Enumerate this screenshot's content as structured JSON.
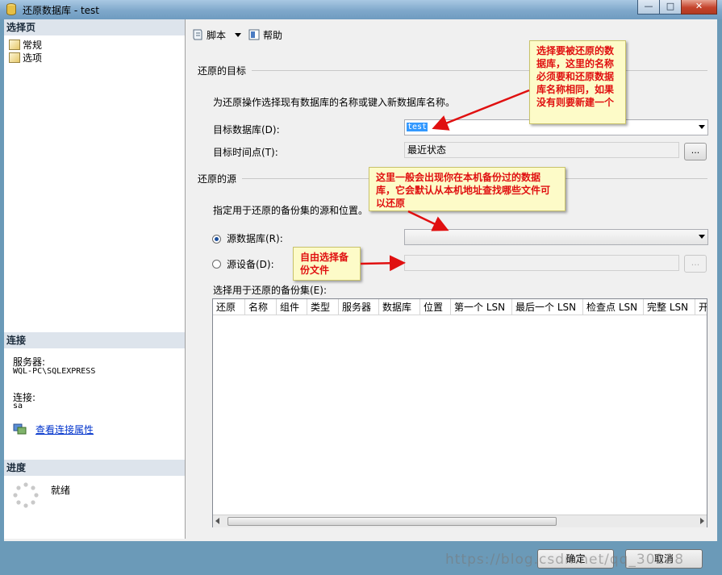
{
  "window": {
    "title": "还原数据库 - test",
    "close_glyph": "✕",
    "max_glyph": "□",
    "min_glyph": "—"
  },
  "left": {
    "select_page_header": "选择页",
    "pages": [
      {
        "label": "常规",
        "icon": "page-general-icon"
      },
      {
        "label": "选项",
        "icon": "page-options-icon"
      }
    ],
    "connection_header": "连接",
    "server_label": "服务器:",
    "server_value": "WQL-PC\\SQLEXPRESS",
    "connection_label": "连接:",
    "connection_value": "sa",
    "view_connection_link": "查看连接属性",
    "progress_header": "进度",
    "status_text": "就绪"
  },
  "toolbar": {
    "script_label": "脚本",
    "help_label": "帮助"
  },
  "restore_target": {
    "group_title": "还原的目标",
    "description": "为还原操作选择现有数据库的名称或键入新数据库名称。",
    "target_db_label": "目标数据库(D):",
    "target_db_value": "test",
    "point_in_time_label": "目标时间点(T):",
    "point_in_time_value": "最近状态",
    "browse_label": "..."
  },
  "restore_source": {
    "group_title": "还原的源",
    "description": "指定用于还原的备份集的源和位置。",
    "from_database_label": "源数据库(R):",
    "from_device_label": "源设备(D):",
    "from_database_selected": true,
    "browse_label": "...",
    "backup_sets_label": "选择用于还原的备份集(E):",
    "columns": [
      "还原",
      "名称",
      "组件",
      "类型",
      "服务器",
      "数据库",
      "位置",
      "第一个 LSN",
      "最后一个 LSN",
      "检查点 LSN",
      "完整 LSN",
      "开"
    ]
  },
  "buttons": {
    "ok_label": "确定",
    "cancel_label": "取消"
  },
  "annotations": {
    "note1": "选择要被还原的数据库，这里的名称必须要和还原数据库名称相同，如果没有则要新建一个",
    "note2": "这里一般会出现你在本机备份过的数据库，它会默认从本机地址查找哪些文件可以还原",
    "note3": "自由选择备份文件"
  },
  "watermark": "https://blog.csdn.net/qq_30228"
}
